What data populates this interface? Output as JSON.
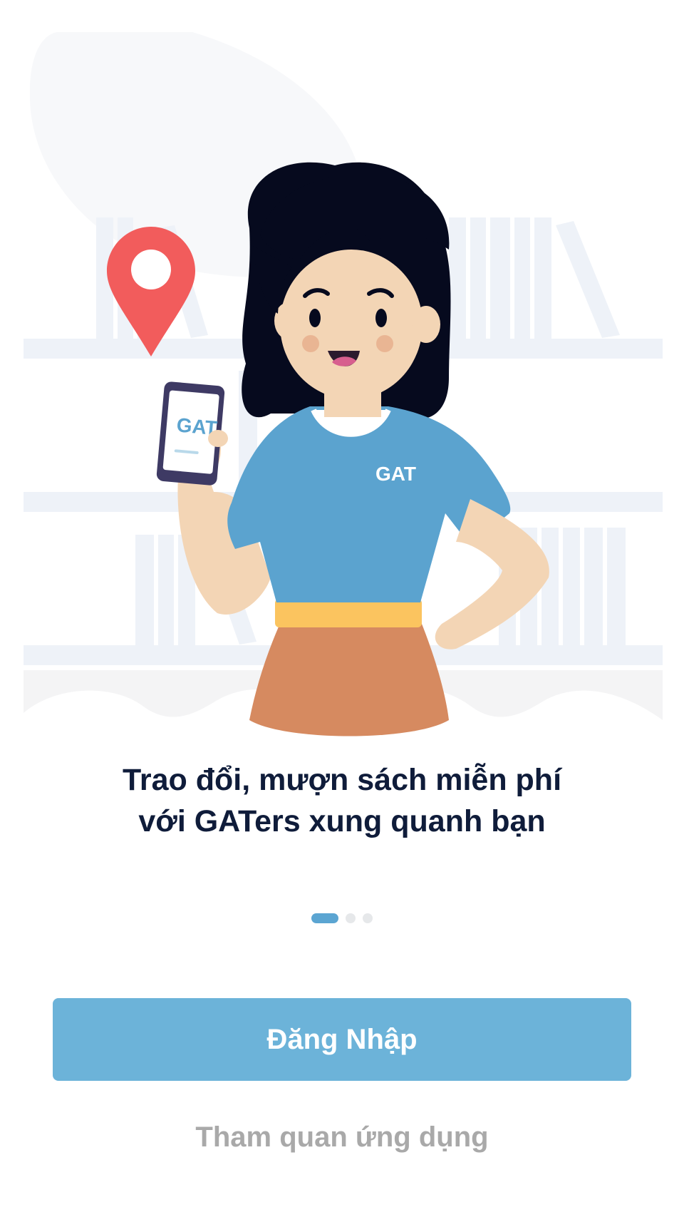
{
  "illustration": {
    "phone_logo": "GAT",
    "shirt_logo": "GAT",
    "icons": [
      "location-pin-icon",
      "smartphone-icon"
    ]
  },
  "onboarding": {
    "headline_line1": "Trao đổi, mượn sách miễn phí",
    "headline_line2": "với GATers xung quanh bạn",
    "page_count": 3,
    "current_page": 1
  },
  "actions": {
    "login_label": "Đăng Nhập",
    "explore_label": "Tham quan ứng dụng"
  },
  "colors": {
    "primary": "#6cb3d9",
    "indicator_active": "#5ba5d2",
    "headline": "#0f1c3a",
    "secondary_text": "#a9a9a9",
    "pin": "#f25c5c",
    "shirt": "#5ba3cf"
  }
}
